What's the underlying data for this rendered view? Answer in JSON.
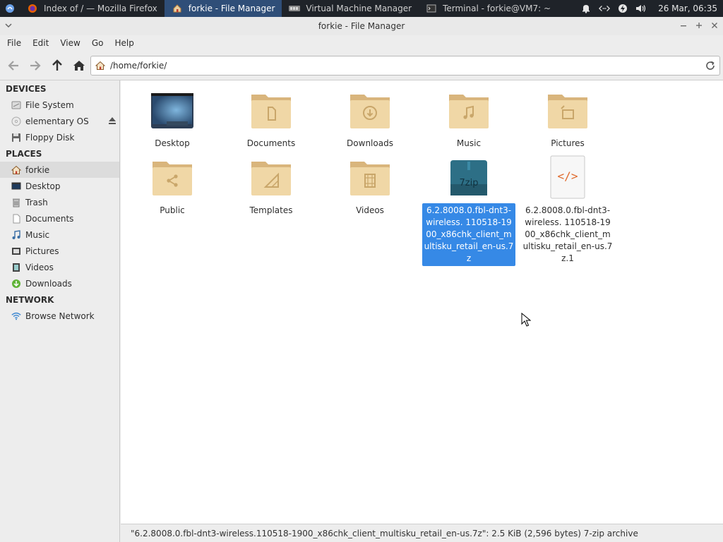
{
  "taskbar": {
    "tasks": [
      {
        "label": "Index of / — Mozilla Firefox"
      },
      {
        "label": "forkie - File Manager"
      },
      {
        "label": "Virtual Machine Manager"
      },
      {
        "label": "Terminal - forkie@VM7: ~"
      }
    ],
    "clock": "26 Mar, 06:35"
  },
  "window": {
    "title": "forkie - File Manager"
  },
  "menubar": {
    "items": [
      "File",
      "Edit",
      "View",
      "Go",
      "Help"
    ]
  },
  "location": {
    "path": "/home/forkie/"
  },
  "sidebar": {
    "devices_header": "DEVICES",
    "devices": [
      {
        "label": "File System"
      },
      {
        "label": "elementary OS"
      },
      {
        "label": "Floppy Disk"
      }
    ],
    "places_header": "PLACES",
    "places": [
      {
        "label": "forkie"
      },
      {
        "label": "Desktop"
      },
      {
        "label": "Trash"
      },
      {
        "label": "Documents"
      },
      {
        "label": "Music"
      },
      {
        "label": "Pictures"
      },
      {
        "label": "Videos"
      },
      {
        "label": "Downloads"
      }
    ],
    "network_header": "NETWORK",
    "network": [
      {
        "label": "Browse Network"
      }
    ]
  },
  "files": [
    {
      "name": "Desktop",
      "kind": "desktop"
    },
    {
      "name": "Documents",
      "kind": "folder-documents"
    },
    {
      "name": "Downloads",
      "kind": "folder-downloads"
    },
    {
      "name": "Music",
      "kind": "folder-music"
    },
    {
      "name": "Pictures",
      "kind": "folder-pictures"
    },
    {
      "name": "Public",
      "kind": "folder-public"
    },
    {
      "name": "Templates",
      "kind": "folder-templates"
    },
    {
      "name": "Videos",
      "kind": "folder-videos"
    },
    {
      "name": "6.2.8008.0.fbl-dnt3-wireless. 110518-1900_x86chk_client_multisku_retail_en-us.7z",
      "kind": "7zip-archive",
      "icon_text": "7zip",
      "selected": true
    },
    {
      "name": "6.2.8008.0.fbl-dnt3-wireless. 110518-1900_x86chk_client_multisku_retail_en-us.7z.1",
      "kind": "code-file",
      "icon_text": "</>"
    }
  ],
  "status": "\"6.2.8008.0.fbl-dnt3-wireless.110518-1900_x86chk_client_multisku_retail_en-us.7z\": 2.5 KiB (2,596 bytes) 7-zip archive",
  "colors": {
    "selection": "#3689e6",
    "folder": "#e8cfa0",
    "taskbar": "#1f2329",
    "active_task": "#2f4e78"
  }
}
